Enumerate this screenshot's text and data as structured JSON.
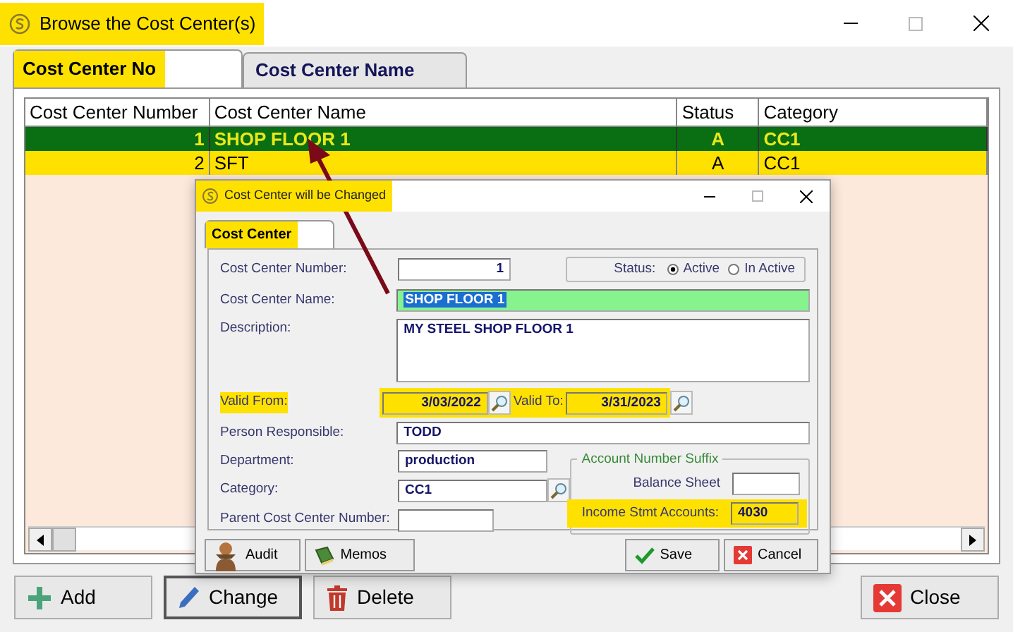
{
  "window": {
    "title": "Browse the Cost Center(s)",
    "highlighted": true
  },
  "tabs": [
    {
      "label": "Cost Center No",
      "selected": true,
      "highlighted": true
    },
    {
      "label": "Cost Center Name",
      "selected": false,
      "highlighted": false
    }
  ],
  "table": {
    "columns": [
      "Cost Center Number",
      "Cost Center Name",
      "Status",
      "Category"
    ],
    "rows": [
      {
        "cells": [
          "1",
          "SHOP FLOOR 1",
          "A",
          "CC1"
        ],
        "selected": true
      },
      {
        "cells": [
          "2",
          "SFT",
          "A",
          "CC1"
        ],
        "selected": false
      }
    ]
  },
  "buttons": [
    {
      "label": "Add",
      "kind": "add",
      "focused": false
    },
    {
      "label": "Change",
      "kind": "change",
      "focused": true
    },
    {
      "label": "Delete",
      "kind": "delete",
      "focused": false
    },
    {
      "label": "Close",
      "kind": "close",
      "focused": false
    }
  ],
  "dialog": {
    "title": "Cost Center will be Changed",
    "highlighted": true,
    "tabs": [
      {
        "label": "Cost Center",
        "selected": true,
        "highlighted": true
      }
    ],
    "number": {
      "label": "Cost Center Number:",
      "value": "1"
    },
    "status": {
      "label": "Status:",
      "options": [
        {
          "label": "Active",
          "selected": true
        },
        {
          "label": "In Active",
          "selected": false
        }
      ]
    },
    "name": {
      "label": "Cost Center Name:",
      "value": "SHOP FLOOR 1"
    },
    "description": {
      "label": "Description:",
      "value": "MY STEEL SHOP FLOOR 1"
    },
    "valid_from": {
      "label": "Valid From:",
      "value": "3/03/2022",
      "highlighted": true
    },
    "valid_to": {
      "label": "Valid To:",
      "value": "3/31/2023",
      "highlighted": true
    },
    "person": {
      "label": "Person Responsible:",
      "value": "TODD"
    },
    "department": {
      "label": "Department:",
      "value": "production"
    },
    "category": {
      "label": "Category:",
      "value": "CC1"
    },
    "parent": {
      "label": "Parent Cost Center Number:"
    },
    "suffix": {
      "title": "Account Number Suffix",
      "balance_sheet": {
        "label": "Balance Sheet"
      },
      "income": {
        "label": "Income Stmt Accounts:",
        "value": "4030",
        "highlighted": true
      }
    },
    "buttons": [
      {
        "label": "Audit",
        "kind": "audit"
      },
      {
        "label": "Memos",
        "kind": "memos"
      },
      {
        "label": "Save",
        "kind": "save"
      },
      {
        "label": "Cancel",
        "kind": "cancel"
      }
    ]
  }
}
